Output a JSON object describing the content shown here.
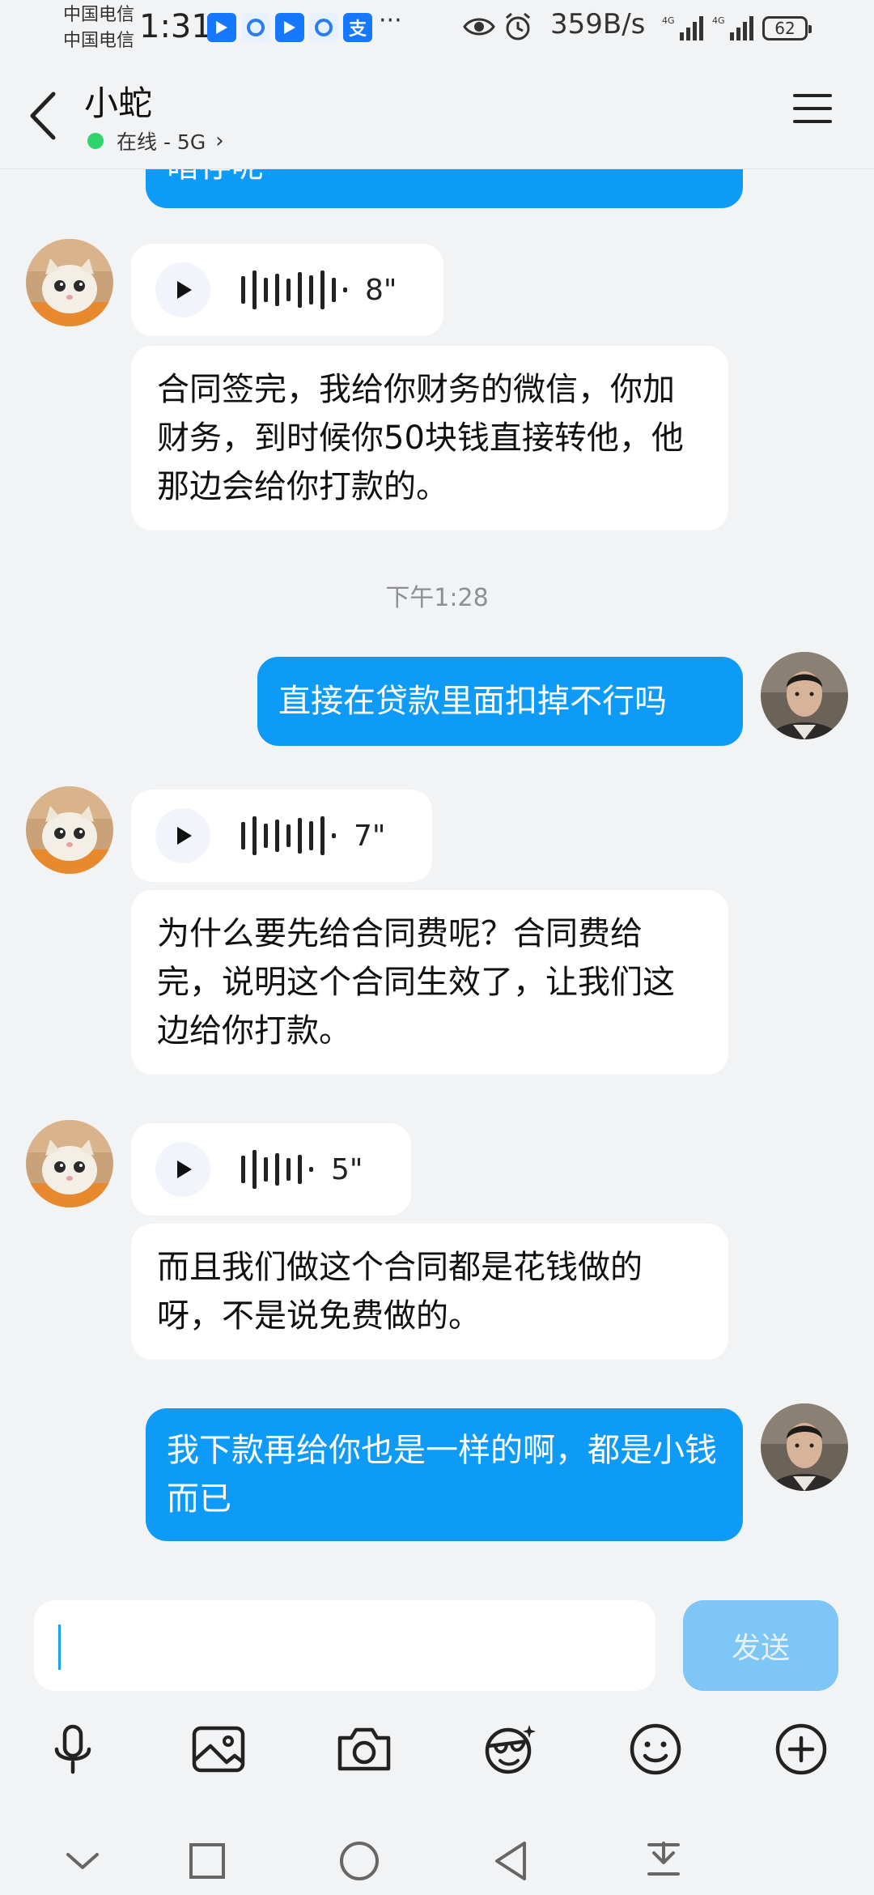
{
  "status_bar": {
    "carrier_1": "中国电信",
    "carrier_2": "中国电信",
    "time": "1:31",
    "more": "···",
    "net_speed": "359B/s",
    "battery": "62",
    "app_icons": [
      "maps-icon",
      "browser-icon",
      "maps-icon",
      "browser-icon",
      "alipay-icon"
    ]
  },
  "header": {
    "title": "小蛇",
    "presence": "在线 - 5G"
  },
  "messages": {
    "top_bubble_partial": "暗存呢",
    "voice_1": {
      "duration": "8\""
    },
    "text_1": "合同签完，我给你财务的微信，你加财务，到时候你50块钱直接转他，他那边会给你打款的。",
    "timestamp": "下午1:28",
    "sent_1": "直接在贷款里面扣掉不行吗",
    "voice_2": {
      "duration": "7\""
    },
    "text_2": "为什么要先给合同费呢？合同费给完，说明这个合同生效了，让我们这边给你打款。",
    "voice_3": {
      "duration": "5\""
    },
    "text_3": "而且我们做这个合同都是花钱做的呀，不是说免费做的。",
    "sent_2": "我下款再给你也是一样的啊，都是小钱而已"
  },
  "input": {
    "value": "",
    "send_label": "发送"
  },
  "colors": {
    "sent_bubble": "#0e9bf7",
    "send_button_disabled": "#7ec6f6",
    "online_dot": "#2fd56a"
  }
}
